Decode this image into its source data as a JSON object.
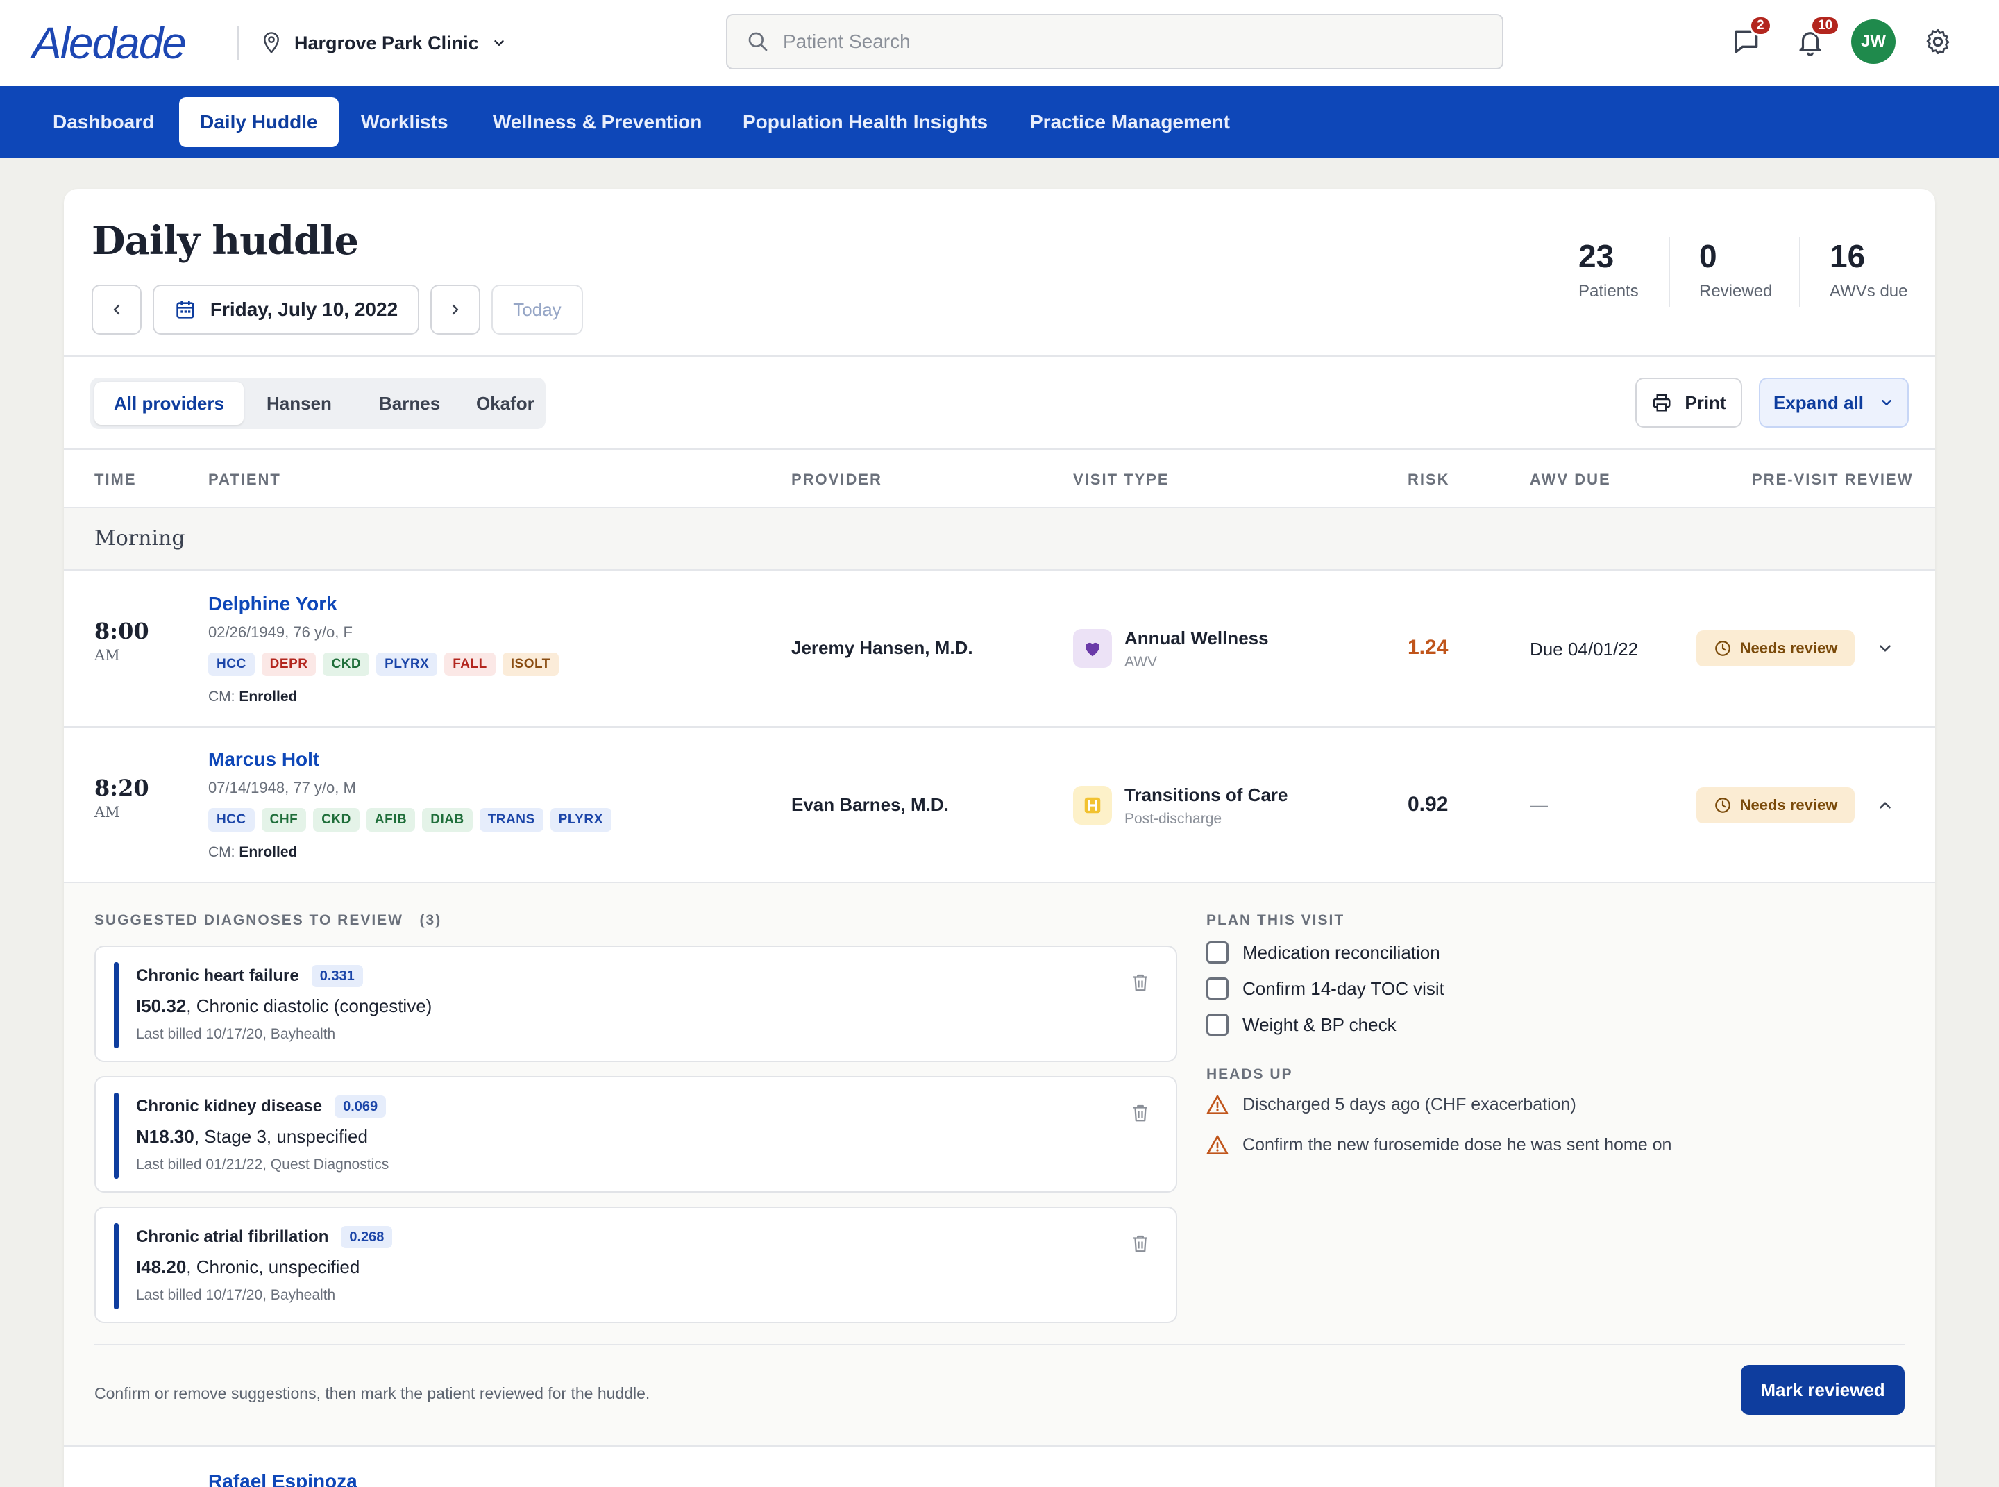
{
  "header": {
    "logo": "Aledade",
    "clinic": "Hargrove Park Clinic",
    "search_placeholder": "Patient Search",
    "messages_count": "2",
    "notifications_count": "10",
    "avatar_initials": "JW"
  },
  "nav": {
    "items": [
      "Dashboard",
      "Daily Huddle",
      "Worklists",
      "Wellness & Prevention",
      "Population Health Insights",
      "Practice Management"
    ],
    "active": "Daily Huddle"
  },
  "page": {
    "title": "Daily huddle",
    "date": "Friday, July 10, 2022",
    "today_label": "Today"
  },
  "stats": [
    {
      "value": "23",
      "label": "Patients"
    },
    {
      "value": "0",
      "label": "Reviewed"
    },
    {
      "value": "16",
      "label": "AWVs due"
    }
  ],
  "provider_tabs": [
    "All providers",
    "Hansen",
    "Barnes",
    "Okafor"
  ],
  "actions": {
    "print": "Print",
    "expand_all": "Expand all"
  },
  "table": {
    "headers": [
      "TIME",
      "PATIENT",
      "PROVIDER",
      "VISIT TYPE",
      "RISK",
      "AWV DUE",
      "PRE-VISIT REVIEW"
    ],
    "section": "Morning",
    "rows": [
      {
        "time": "8:00",
        "ampm": "AM",
        "name": "Delphine York",
        "meta": "02/26/1949, 76 y/o, F",
        "tags": [
          "HCC",
          "DEPR",
          "CKD",
          "PLYRX",
          "FALL",
          "ISOLT"
        ],
        "cm_label": "CM:",
        "cm_value": "Enrolled",
        "provider": "Jeremy Hansen, M.D.",
        "visit_type": "Annual Wellness",
        "visit_sub": "AWV",
        "risk": "1.24",
        "awv_due": "Due 04/01/22",
        "review": "Needs review"
      },
      {
        "time": "8:20",
        "ampm": "AM",
        "name": "Marcus Holt",
        "meta": "07/14/1948, 77 y/o, M",
        "tags": [
          "HCC",
          "CHF",
          "CKD",
          "AFIB",
          "DIAB",
          "TRANS",
          "PLYRX"
        ],
        "cm_label": "CM:",
        "cm_value": "Enrolled",
        "provider": "Evan Barnes, M.D.",
        "visit_type": "Transitions of Care",
        "visit_sub": "Post-discharge",
        "risk": "0.92",
        "awv_due": "—",
        "review": "Needs review"
      }
    ],
    "next_row_name": "Rafael Espinoza"
  },
  "panel": {
    "suggested_heading": "SUGGESTED DIAGNOSES TO REVIEW",
    "suggested_count": "(3)",
    "diagnoses": [
      {
        "title": "Chronic heart failure",
        "score": "0.331",
        "code": "I50.32",
        "desc": ", Chronic diastolic (congestive)",
        "last": "Last billed 10/17/20, Bayhealth"
      },
      {
        "title": "Chronic kidney disease",
        "score": "0.069",
        "code": "N18.30",
        "desc": ", Stage 3, unspecified",
        "last": "Last billed 01/21/22, Quest Diagnostics"
      },
      {
        "title": "Chronic atrial fibrillation",
        "score": "0.268",
        "code": "I48.20",
        "desc": ", Chronic, unspecified",
        "last": "Last billed 10/17/20, Bayhealth"
      }
    ],
    "plan_heading": "PLAN THIS VISIT",
    "plan_items": [
      "Medication reconciliation",
      "Confirm 14-day TOC visit",
      "Weight & BP check"
    ],
    "heads_up_heading": "HEADS UP",
    "heads_up_items": [
      "Discharged 5 days ago (CHF exacerbation)",
      "Confirm the new furosemide dose he was sent home on"
    ],
    "footer_note": "Confirm or remove suggestions, then mark the patient reviewed for the huddle.",
    "mark_reviewed": "Mark reviewed"
  },
  "colors": {
    "brand": "#0e47b8",
    "primary_button": "#0e3d9e",
    "risk_high": "#c0551b",
    "needs_review_bg": "#fbecd3",
    "avatar": "#1f8a4c",
    "badge": "#b3261e"
  }
}
